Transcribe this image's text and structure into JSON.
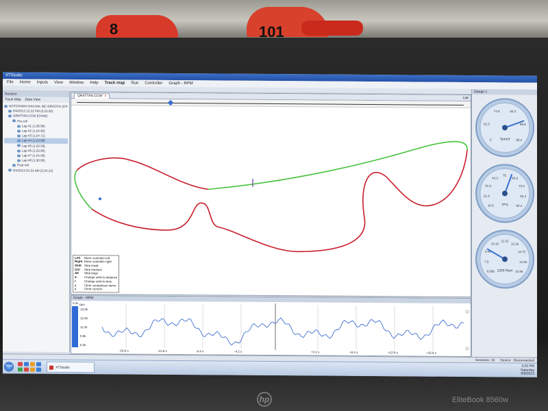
{
  "app": {
    "title": "XTStudio",
    "menus": [
      "File",
      "Home",
      "Inputs",
      "View",
      "Window",
      "Help",
      "Track map",
      "Run",
      "Controller",
      "Graph - RPM"
    ]
  },
  "left_panel": {
    "header": "Session",
    "tabs": [
      "Track Map",
      "Data View"
    ],
    "tree": [
      {
        "label": "NOTCHWAH NACHAL BE ISROOTH (GPC R.)",
        "level": 0
      },
      {
        "label": "6/4/2013 12:22 PM (3:23.00)",
        "level": 1
      },
      {
        "label": "QRATTAN.CCW [CHAK]",
        "level": 1
      },
      {
        "label": "Pre-roll",
        "level": 2
      },
      {
        "label": "Lap #1 (1:28.96)",
        "level": 3
      },
      {
        "label": "Lap #2 (1:24.92)",
        "level": 3
      },
      {
        "label": "Lap #3 (1:24.71)",
        "level": 3
      },
      {
        "label": "Lap #4 (1:23.89)",
        "level": 3,
        "selected": true
      },
      {
        "label": "Lap #5 (1:23.59)",
        "level": 3
      },
      {
        "label": "Lap #6 (1:23.90)",
        "level": 3
      },
      {
        "label": "Lap #7 (1:24.56)",
        "level": 3
      },
      {
        "label": "Lap #8 (1:30.95)",
        "level": 3
      },
      {
        "label": "Post-roll",
        "level": 2
      },
      {
        "label": "6/4/2013 01:31 AM (2:24.12)",
        "level": 1
      }
    ]
  },
  "map_window": {
    "tab_label": "QRATTAN.CCW",
    "tab_close": "×",
    "right_label": "Lap",
    "slider_position": 0.24,
    "keys": [
      {
        "key": "Left",
        "action": "Move controller left"
      },
      {
        "key": "Right",
        "action": "Move controller right"
      },
      {
        "key": "Shift",
        "action": "Step small"
      },
      {
        "key": "Ctrl",
        "action": "Step medium"
      },
      {
        "key": "Alt",
        "action": "Step large"
      },
      {
        "key": "d",
        "action": "Change units to distance"
      },
      {
        "key": "t",
        "action": "Change units to time"
      },
      {
        "key": "x",
        "action": "Clear comparison items"
      },
      {
        "key": "c",
        "action": "Clear cursors"
      }
    ]
  },
  "graph_window": {
    "title": "Graph - RPM",
    "series_label": "rpm",
    "y_ticks": [
      "13.8k",
      "12.6k",
      "11.2k",
      "9.8k",
      "8.4k"
    ],
    "x_ticks": [
      "-16.8 s",
      "-12.6 s",
      "-8.4 s",
      "-4.2 s",
      "+4.2 s",
      "+8.4 s",
      "+12.6 s",
      "+16.8 s"
    ],
    "side_value": "-5.3s"
  },
  "gauge_panel": {
    "header": "Gauge 1",
    "gauges": [
      {
        "label": "Speed",
        "ticks": [
          "0",
          "61.3",
          "74.5",
          "84.3",
          "88.6",
          "95.2"
        ]
      },
      {
        "label": "TPS",
        "ticks": [
          "10.5",
          "21.9",
          "31.9",
          "43.3",
          "51",
          "60.8",
          "72.0",
          "83.4",
          "90.2"
        ]
      },
      {
        "label": "1000 Rpm",
        "ticks": [
          "8.568",
          "7.5",
          "8.44",
          "10.32",
          "11.31",
          "12.16",
          "13.72",
          "14.00",
          "15.96"
        ]
      }
    ]
  },
  "status_bar": {
    "session": "Sessions: 16",
    "device": "Device : Disconnected"
  },
  "taskbar": {
    "start_label": "Start",
    "task_item": "XTStudio",
    "tray_time": "3:25 PM",
    "tray_day": "Saturday",
    "tray_date": "6/8/2013"
  },
  "laptop": {
    "model": "EliteBook 8560w",
    "logo": "hp"
  },
  "background": {
    "bike_numbers": [
      "8",
      "101"
    ]
  },
  "colors": {
    "track_red": "#c81c2b",
    "track_green": "#44c23a",
    "track_dark": "#3d2a28",
    "rpm_line": "#3f6fd0",
    "rpm_bar": "#2f6ad6"
  }
}
